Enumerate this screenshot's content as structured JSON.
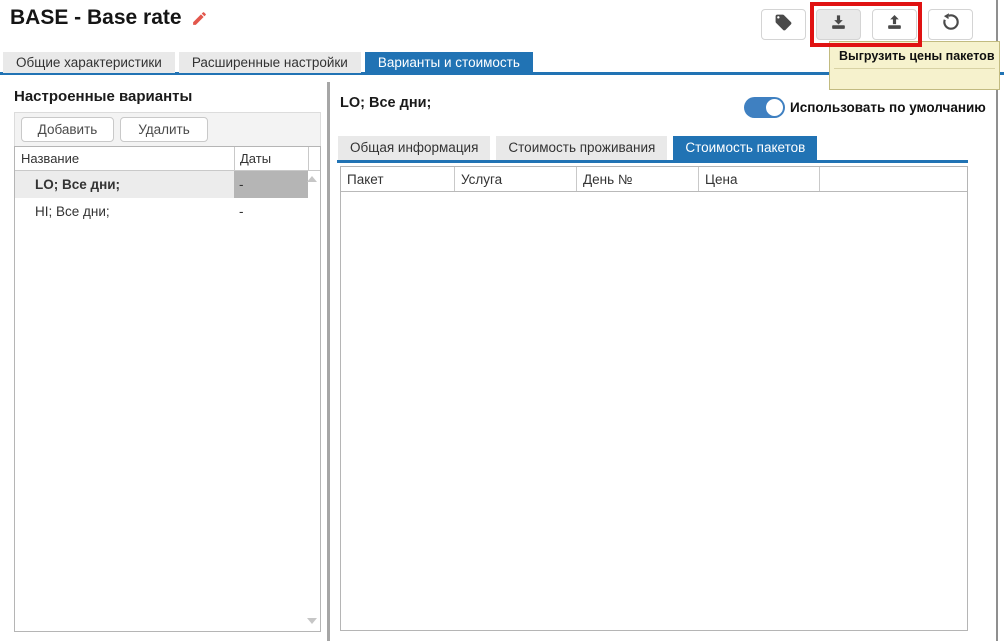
{
  "header": {
    "title": "BASE - Base rate",
    "tooltip": {
      "text": "Выгрузить цены пакетов"
    },
    "buttons": [
      {
        "name": "tag"
      },
      {
        "name": "download"
      },
      {
        "name": "upload"
      },
      {
        "name": "history"
      }
    ]
  },
  "tabs": {
    "items": [
      {
        "label": "Общие характеристики",
        "active": false
      },
      {
        "label": "Расширенные настройки",
        "active": false
      },
      {
        "label": "Варианты и стоимость",
        "active": true
      }
    ]
  },
  "left": {
    "heading": "Настроенные варианты",
    "add_label": "Добавить",
    "delete_label": "Удалить",
    "columns": [
      "Название",
      "Даты"
    ],
    "rows": [
      {
        "name": "LO; Все дни;",
        "dates": "-",
        "selected": true
      },
      {
        "name": "HI; Все дни;",
        "dates": "-",
        "selected": false
      }
    ]
  },
  "right": {
    "title": "LO; Все дни;",
    "toggle": {
      "label": "Использовать по умолчанию",
      "state": "on"
    },
    "tabs": [
      {
        "label": "Общая информация",
        "active": false
      },
      {
        "label": "Стоимость проживания",
        "active": false
      },
      {
        "label": "Стоимость пакетов",
        "active": true
      }
    ],
    "columns": [
      "Пакет",
      "Услуга",
      "День №",
      "Цена",
      ""
    ]
  },
  "colors": {
    "accent_blue": "#2173b4",
    "highlight_red": "#e01212",
    "tooltip_bg": "#f6f2cd",
    "toggle_blue": "#3f80c1",
    "selected_cell_gray": "#b5b5b5",
    "pencil_red": "#e2574c",
    "icon_gray": "#4a4a4a"
  }
}
